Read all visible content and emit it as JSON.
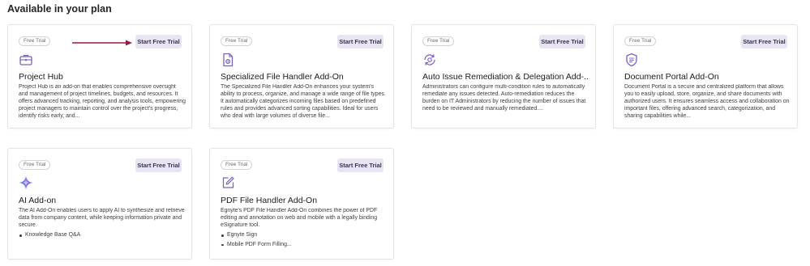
{
  "page": {
    "section_title": "Available in your plan"
  },
  "cards": [
    {
      "badge": "Free Trial",
      "button": "Start Free Trial",
      "icon": "briefcase-icon",
      "title": "Project Hub",
      "description": "Project Hub is an add-on that enables comprehensive oversight and management of project timelines, budgets, and resources. It offers advanced tracking, reporting, and analysis tools, empowering project managers to maintain control over the project's progress, identify risks early, and..."
    },
    {
      "badge": "Free Trial",
      "button": "Start Free Trial",
      "icon": "file-settings-icon",
      "title": "Specialized File Handler Add-On",
      "description": "The Specialized File Handler Add-On enhances your system's ability to process, organize, and manage a wide range of file types. It automatically categorizes incoming files based on predefined rules and provides advanced sorting capabilities. Ideal for users who deal with large volumes of diverse file..."
    },
    {
      "badge": "Free Trial",
      "button": "Start Free Trial",
      "icon": "gear-sync-icon",
      "title": "Auto Issue Remediation & Delegation Add-...",
      "description": "Administrators can configure multi-condition rules to automatically remediate any issues detected. Auto-remediation reduces the burden on IT Administrators by reducing the number of issues that need to be reviewed and manually remediated...."
    },
    {
      "badge": "Free Trial",
      "button": "Start Free Trial",
      "icon": "shield-document-icon",
      "title": "Document Portal Add-On",
      "description": "Document Portal is a secure and centralized platform that allows you to easily upload, store, organize, and share documents with authorized users. It ensures seamless access and collaboration on important files, offering advanced search, categorization, and sharing capabilities while..."
    },
    {
      "badge": "Free Trial",
      "button": "Start Free Trial",
      "icon": "ai-sparkle-icon",
      "title": "AI Add-on",
      "description": "The AI Add-On enables users to apply AI to synthesize and retrieve data from company content, while keeping information private and secure.",
      "features": [
        "Knowledge Base Q&A"
      ]
    },
    {
      "badge": "Free Trial",
      "button": "Start Free Trial",
      "icon": "edit-square-icon",
      "title": "PDF File Handler Add-On",
      "description": "Egnyte's PDF File Handler Add-On combines the power of PDF editing and annotation on web and mobile with a legally binding eSignature tool.",
      "features": [
        "Egnyte Sign",
        "Mobile PDF Form Filling..."
      ]
    }
  ],
  "colors": {
    "accent": "#7b61c4",
    "button_bg": "#e9e4f2",
    "arrow": "#9b1c3a"
  }
}
